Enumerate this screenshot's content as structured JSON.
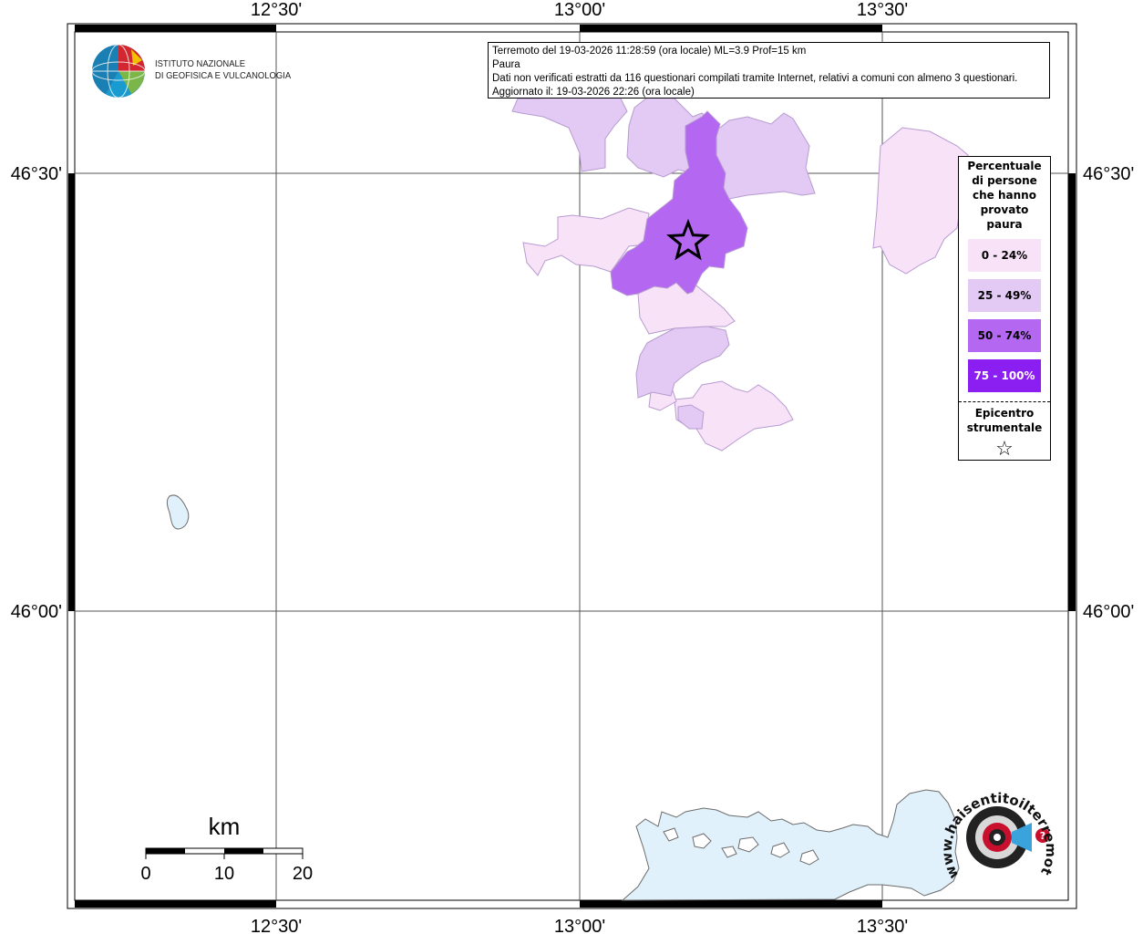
{
  "info": {
    "line1": "Terremoto del 19-03-2026 11:28:59 (ora locale) ML=3.9 Prof=15 km",
    "line2": "Paura",
    "line3": "Dati non verificati estratti da 116 questionari compilati tramite Internet, relativi a comuni con almeno 3 questionari.",
    "line4": "Aggiornato il: 19-03-2026 22:26 (ora locale)"
  },
  "axes": {
    "lon_ticks": [
      "12°30'",
      "13°00'",
      "13°30'"
    ],
    "lat_ticks": [
      "46°30'",
      "46°00'"
    ]
  },
  "scale_bar": {
    "unit": "km",
    "labels": [
      "0",
      "10",
      "20"
    ]
  },
  "legend": {
    "title": "Percentuale di persone che hanno provato paura",
    "classes": [
      {
        "label": "0 - 24%",
        "color": "#f8e2f8",
        "text_color": "#000000"
      },
      {
        "label": "25 - 49%",
        "color": "#e2caf4",
        "text_color": "#000000"
      },
      {
        "label": "50 - 74%",
        "color": "#b467f1",
        "text_color": "#000000"
      },
      {
        "label": "75 - 100%",
        "color": "#8b1ef0",
        "text_color": "#ffffff"
      }
    ],
    "epicenter_title": "Epicentro strumentale",
    "epicenter_symbol": "☆"
  },
  "logos": {
    "ingv_line1": "ISTITUTO NAZIONALE",
    "ingv_line2": "DI GEOFISICA E VULCANOLOGIA",
    "hst_text": "www.haisentitoilterremoto.it"
  },
  "colors": {
    "water": "#e1f1fb",
    "frame": "#000000"
  }
}
